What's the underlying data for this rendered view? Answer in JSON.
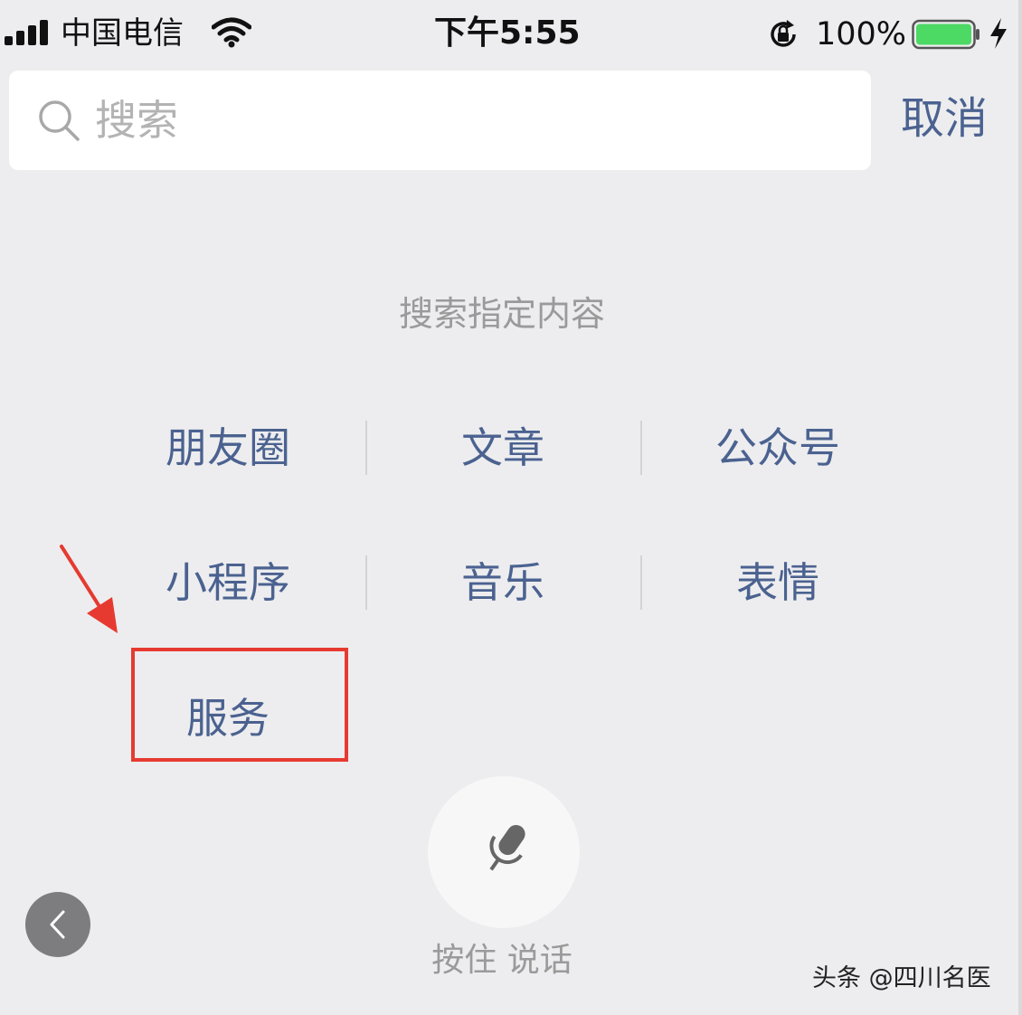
{
  "status_bar": {
    "carrier": "中国电信",
    "time": "下午5:55",
    "battery_percent": "100%",
    "battery_level": 1.0,
    "icons": [
      "signal-icon",
      "wifi-icon",
      "rotation-lock-icon",
      "battery-icon",
      "charging-icon"
    ]
  },
  "search": {
    "placeholder": "搜索",
    "cancel_label": "取消"
  },
  "prompt": {
    "title": "搜索指定内容"
  },
  "categories": [
    {
      "label": "朋友圈"
    },
    {
      "label": "文章"
    },
    {
      "label": "公众号"
    },
    {
      "label": "小程序"
    },
    {
      "label": "音乐"
    },
    {
      "label": "表情"
    },
    {
      "label": "服务"
    }
  ],
  "voice": {
    "hint": "按住 说话",
    "icon": "microphone-icon"
  },
  "back": {
    "icon": "chevron-left-icon"
  },
  "watermark": {
    "text": "头条 @四川名医"
  },
  "colors": {
    "background": "#ededef",
    "link": "#4b6290",
    "highlight": "#e63a30",
    "battery": "#4cd964"
  }
}
